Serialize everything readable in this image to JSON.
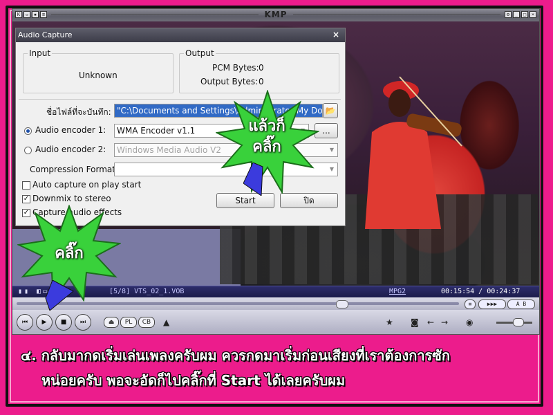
{
  "player": {
    "title": "KMP",
    "status": {
      "file": "[5/8] VTS_02_1.VOB",
      "codec": "MPG2",
      "time": "00:15:54 / 00:24:37"
    },
    "pill_buttons": [
      "PL",
      "CB"
    ]
  },
  "dialog": {
    "title": "Audio Capture",
    "close_glyph": "×",
    "input": {
      "label": "Input",
      "value": "Unknown"
    },
    "output": {
      "label": "Output",
      "pcm_label": "PCM Bytes:",
      "pcm_value": "0",
      "out_label": "Output Bytes:",
      "out_value": "0"
    },
    "filename_label": "ชื่อไฟล์ที่จะบันทึก:",
    "filename_value": "\"C:\\Documents and Settings\\Administrator\\My Documents",
    "encoder1_label": "Audio encoder 1:",
    "encoder1_value": "WMA Encoder v1.1",
    "encoder1_more": "...",
    "encoder2_label": "Audio encoder 2:",
    "encoder2_value": "Windows Media Audio V2",
    "compression_label": "Compression Format:",
    "compression_value": "",
    "checkboxes": [
      {
        "label": "Auto capture on play start",
        "checked": false
      },
      {
        "label": "Downmix to stereo",
        "checked": true
      },
      {
        "label": "Capture audio effects",
        "checked": true
      }
    ],
    "start_button": "Start",
    "close_button": "ปิด"
  },
  "callouts": {
    "top_line1": "แล้วก็",
    "top_line2": "คลิ๊ก",
    "bottom": "คลิ๊ก"
  },
  "caption": {
    "line1": "๔. กลับมากดเริ่มเล่นเพลงครับผม ควรกดมาเริ่มก่อนเสียงที่เราต้องการซัก",
    "line2": "หน่อยครับ พอจะอัดก็ไปคลิ๊กที่ Start ได้เลยครับผม"
  },
  "colors": {
    "background": "#ec1c8c",
    "burst": "#39d13b",
    "arrow": "#3b3bdd"
  }
}
